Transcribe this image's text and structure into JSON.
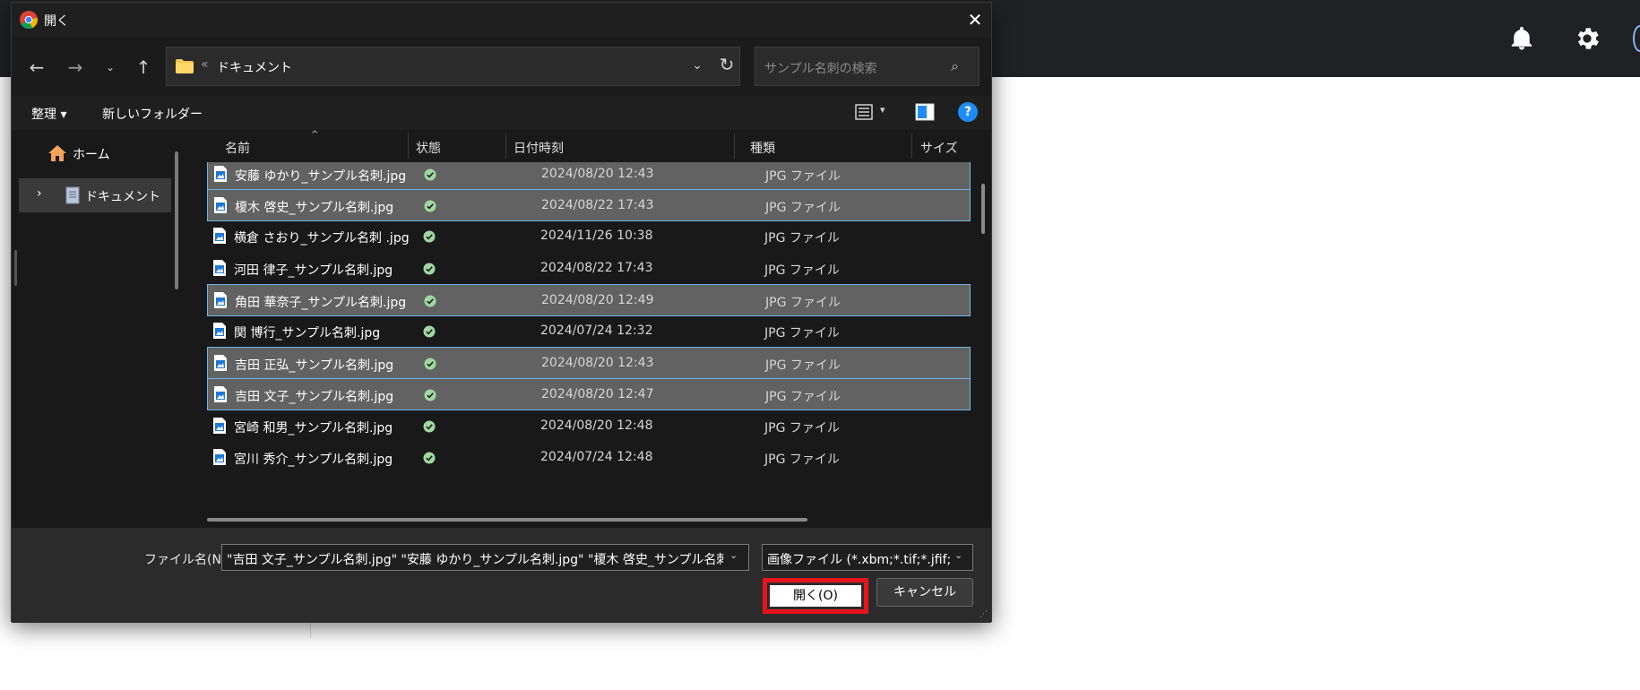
{
  "dialog": {
    "title": "開く",
    "close_glyph": "✕"
  },
  "nav": {
    "back_glyph": "←",
    "forward_glyph": "→",
    "recent_glyph": "⌄",
    "up_glyph": "↑",
    "breadcrumb_chevron": "«",
    "address": "ドキュメント",
    "address_dropdown_glyph": "⌄",
    "refresh_glyph": "↻",
    "search_placeholder": "サンプル名刺の検索",
    "search_glyph": "⌕"
  },
  "toolbar": {
    "organize": "整理 ▾",
    "new_folder": "新しいフォルダー",
    "view_chevron": "▾",
    "help_glyph": "?"
  },
  "sidebar": {
    "home_label": "ホーム",
    "documents_label": "ドキュメント",
    "expand_glyph": "›"
  },
  "columns": {
    "name": "名前",
    "status": "状態",
    "date": "日付時刻",
    "type": "種類",
    "size": "サイズ",
    "sort_glyph": "^"
  },
  "files": [
    {
      "name": "安藤 ゆかり_サンプル名刺.jpg",
      "date": "2024/08/20 12:43",
      "type": "JPG ファイル",
      "selected": true
    },
    {
      "name": "榎木 啓史_サンプル名刺.jpg",
      "date": "2024/08/22 17:43",
      "type": "JPG ファイル",
      "selected": true
    },
    {
      "name": "横倉 さおり_サンプル名刺 .jpg",
      "date": "2024/11/26 10:38",
      "type": "JPG ファイル",
      "selected": false
    },
    {
      "name": "河田 律子_サンプル名刺.jpg",
      "date": "2024/08/22 17:43",
      "type": "JPG ファイル",
      "selected": false
    },
    {
      "name": "角田 華奈子_サンプル名刺.jpg",
      "date": "2024/08/20 12:49",
      "type": "JPG ファイル",
      "selected": true
    },
    {
      "name": "関 博行_サンプル名刺.jpg",
      "date": "2024/07/24 12:32",
      "type": "JPG ファイル",
      "selected": false
    },
    {
      "name": "吉田 正弘_サンプル名刺.jpg",
      "date": "2024/08/20 12:43",
      "type": "JPG ファイル",
      "selected": true
    },
    {
      "name": "吉田 文子_サンプル名刺.jpg",
      "date": "2024/08/20 12:47",
      "type": "JPG ファイル",
      "selected": true
    },
    {
      "name": "宮崎 和男_サンプル名刺.jpg",
      "date": "2024/08/20 12:48",
      "type": "JPG ファイル",
      "selected": false
    },
    {
      "name": "宮川 秀介_サンプル名刺.jpg",
      "date": "2024/07/24 12:48",
      "type": "JPG ファイル",
      "selected": false
    }
  ],
  "footer": {
    "filename_label": "ファイル名(N):",
    "filename_value": "\"吉田 文子_サンプル名刺.jpg\" \"安藤 ゆかり_サンプル名刺.jpg\" \"榎木 啓史_サンプル名刺.jpg\"",
    "dropdown_glyph": "⌄",
    "filetype_value": "画像ファイル (*.xbm;*.tif;*.jfif;*.pjp",
    "open_label": "開く(O)",
    "cancel_label": "キャンセル",
    "grip_glyph": "⋰"
  },
  "colors": {
    "selection_bg": "#626262",
    "selection_border": "#6fb6e6",
    "status_ok": "#9fd89f",
    "highlight_red": "#e8141c"
  }
}
